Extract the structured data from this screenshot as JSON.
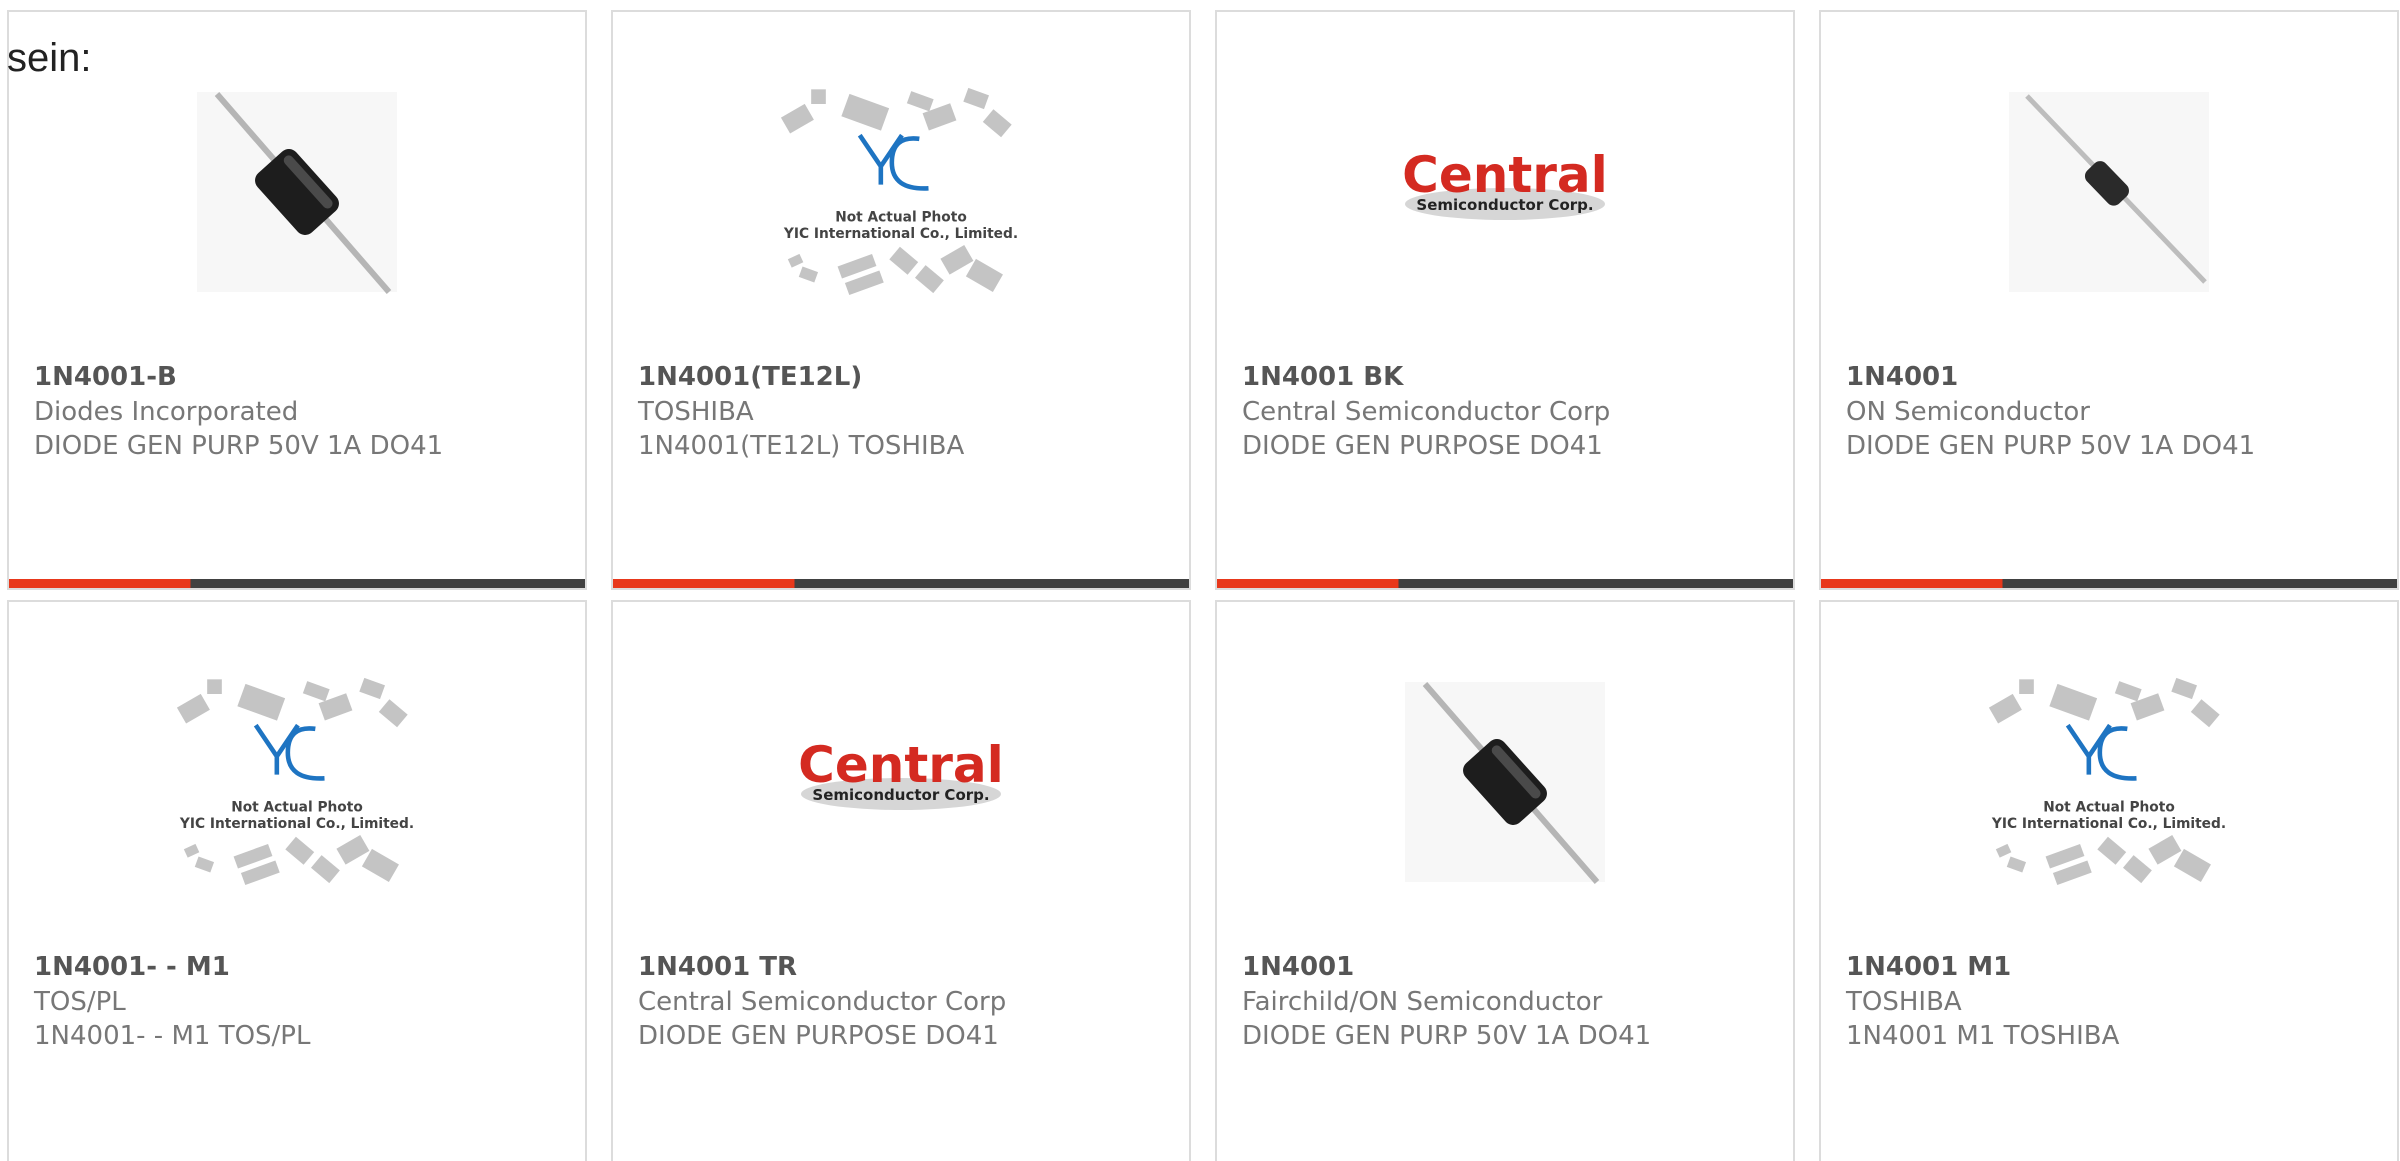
{
  "intro_text": "sein:",
  "colors": {
    "accent": "#e8381b",
    "bar_dark": "#414141",
    "border": "#dcdcdc"
  },
  "products": [
    {
      "part": "1N4001-B",
      "manufacturer": "Diodes Incorporated",
      "description": "DIODE GEN PURP 50V 1A DO41",
      "image": "diode-diagonal-image"
    },
    {
      "part": "1N4001(TE12L)",
      "manufacturer": "TOSHIBA",
      "description": "1N4001(TE12L) TOSHIBA",
      "image": "yic-placeholder-image",
      "image_text": [
        "Not Actual Photo",
        "YIC International Co., Limited."
      ]
    },
    {
      "part": "1N4001 BK",
      "manufacturer": "Central Semiconductor Corp",
      "description": "DIODE GEN PURPOSE DO41",
      "image": "central-logo-image",
      "image_text": [
        "Central",
        "Semiconductor Corp."
      ]
    },
    {
      "part": "1N4001",
      "manufacturer": "ON Semiconductor",
      "description": "DIODE GEN PURP 50V 1A DO41",
      "image": "diode-thin-image"
    },
    {
      "part": "1N4001- - M1",
      "manufacturer": "TOS/PL",
      "description": "1N4001- - M1 TOS/PL",
      "image": "yic-placeholder-image",
      "image_text": [
        "Not Actual Photo",
        "YIC International Co., Limited."
      ]
    },
    {
      "part": "1N4001 TR",
      "manufacturer": "Central Semiconductor Corp",
      "description": "DIODE GEN PURPOSE DO41",
      "image": "central-logo-image",
      "image_text": [
        "Central",
        "Semiconductor Corp."
      ]
    },
    {
      "part": "1N4001",
      "manufacturer": "Fairchild/ON Semiconductor",
      "description": "DIODE GEN PURP 50V 1A DO41",
      "image": "diode-diagonal-image"
    },
    {
      "part": "1N4001 M1",
      "manufacturer": "TOSHIBA",
      "description": "1N4001 M1 TOSHIBA",
      "image": "yic-placeholder-image",
      "image_text": [
        "Not Actual Photo",
        "YIC International Co., Limited."
      ]
    }
  ]
}
